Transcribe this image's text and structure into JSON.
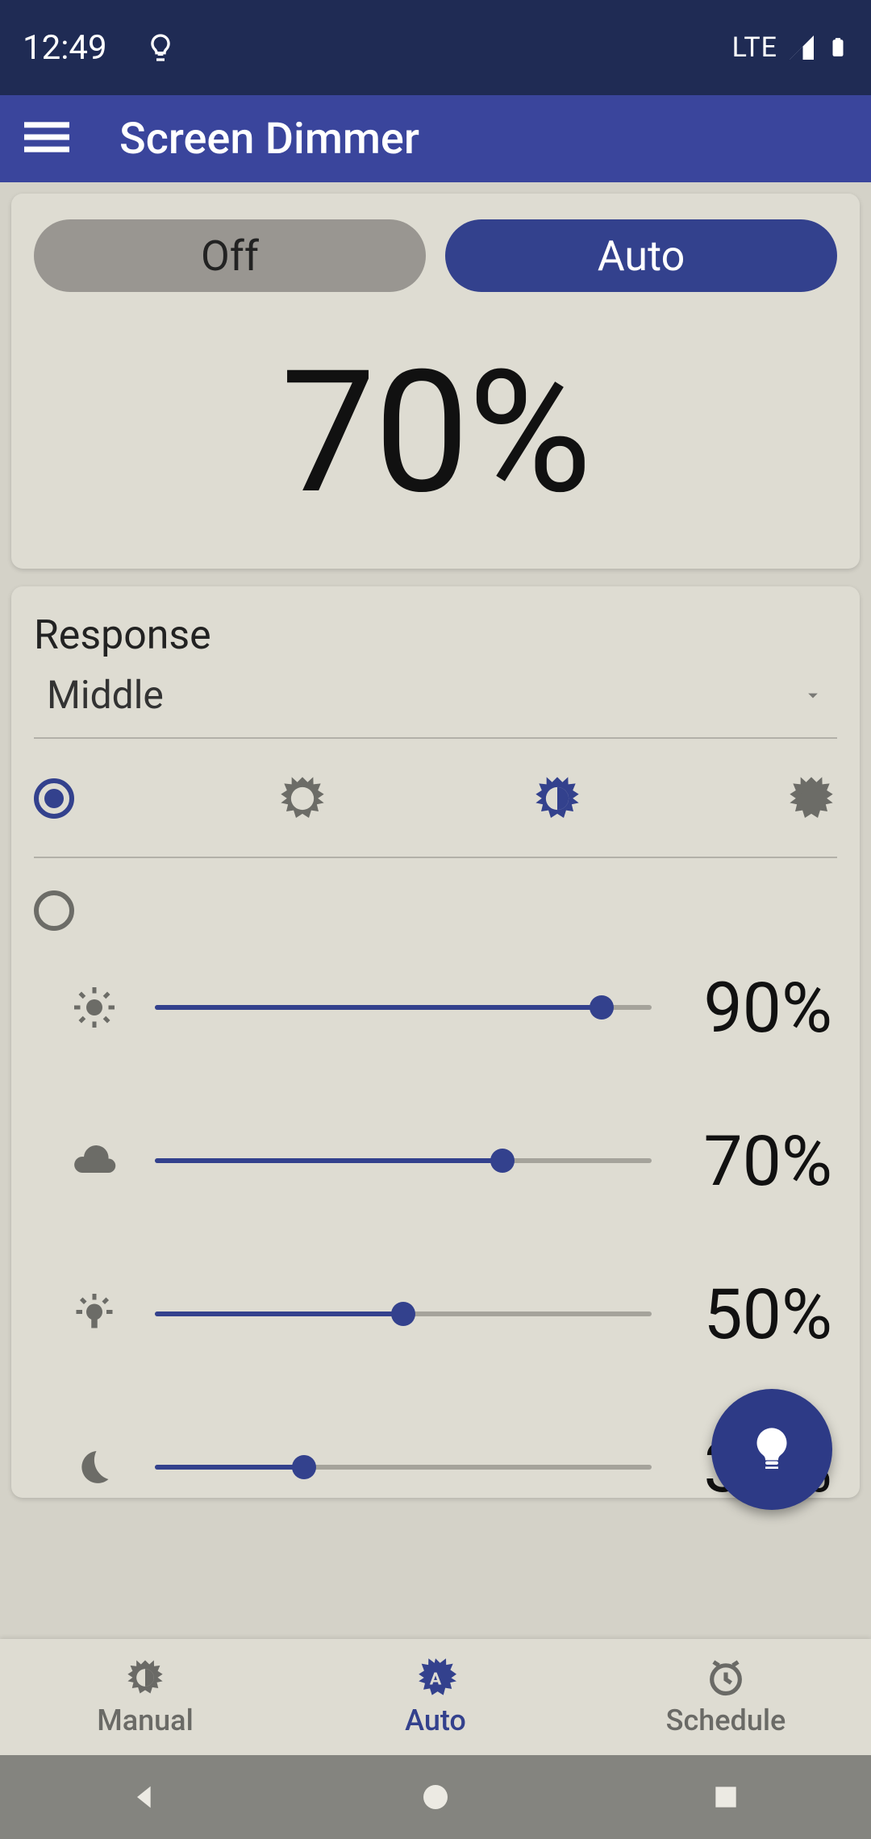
{
  "statusbar": {
    "time": "12:49",
    "network": "LTE"
  },
  "appbar": {
    "title": "Screen Dimmer"
  },
  "mode": {
    "off_label": "Off",
    "auto_label": "Auto",
    "current_percent": "70%"
  },
  "response": {
    "label": "Response",
    "value": "Middle"
  },
  "sliders": [
    {
      "percent_label": "90%",
      "value": 90
    },
    {
      "percent_label": "70%",
      "value": 70
    },
    {
      "percent_label": "50%",
      "value": 50
    },
    {
      "percent_label": "30%",
      "value": 30
    }
  ],
  "bottom_nav": {
    "manual": "Manual",
    "auto": "Auto",
    "schedule": "Schedule"
  }
}
